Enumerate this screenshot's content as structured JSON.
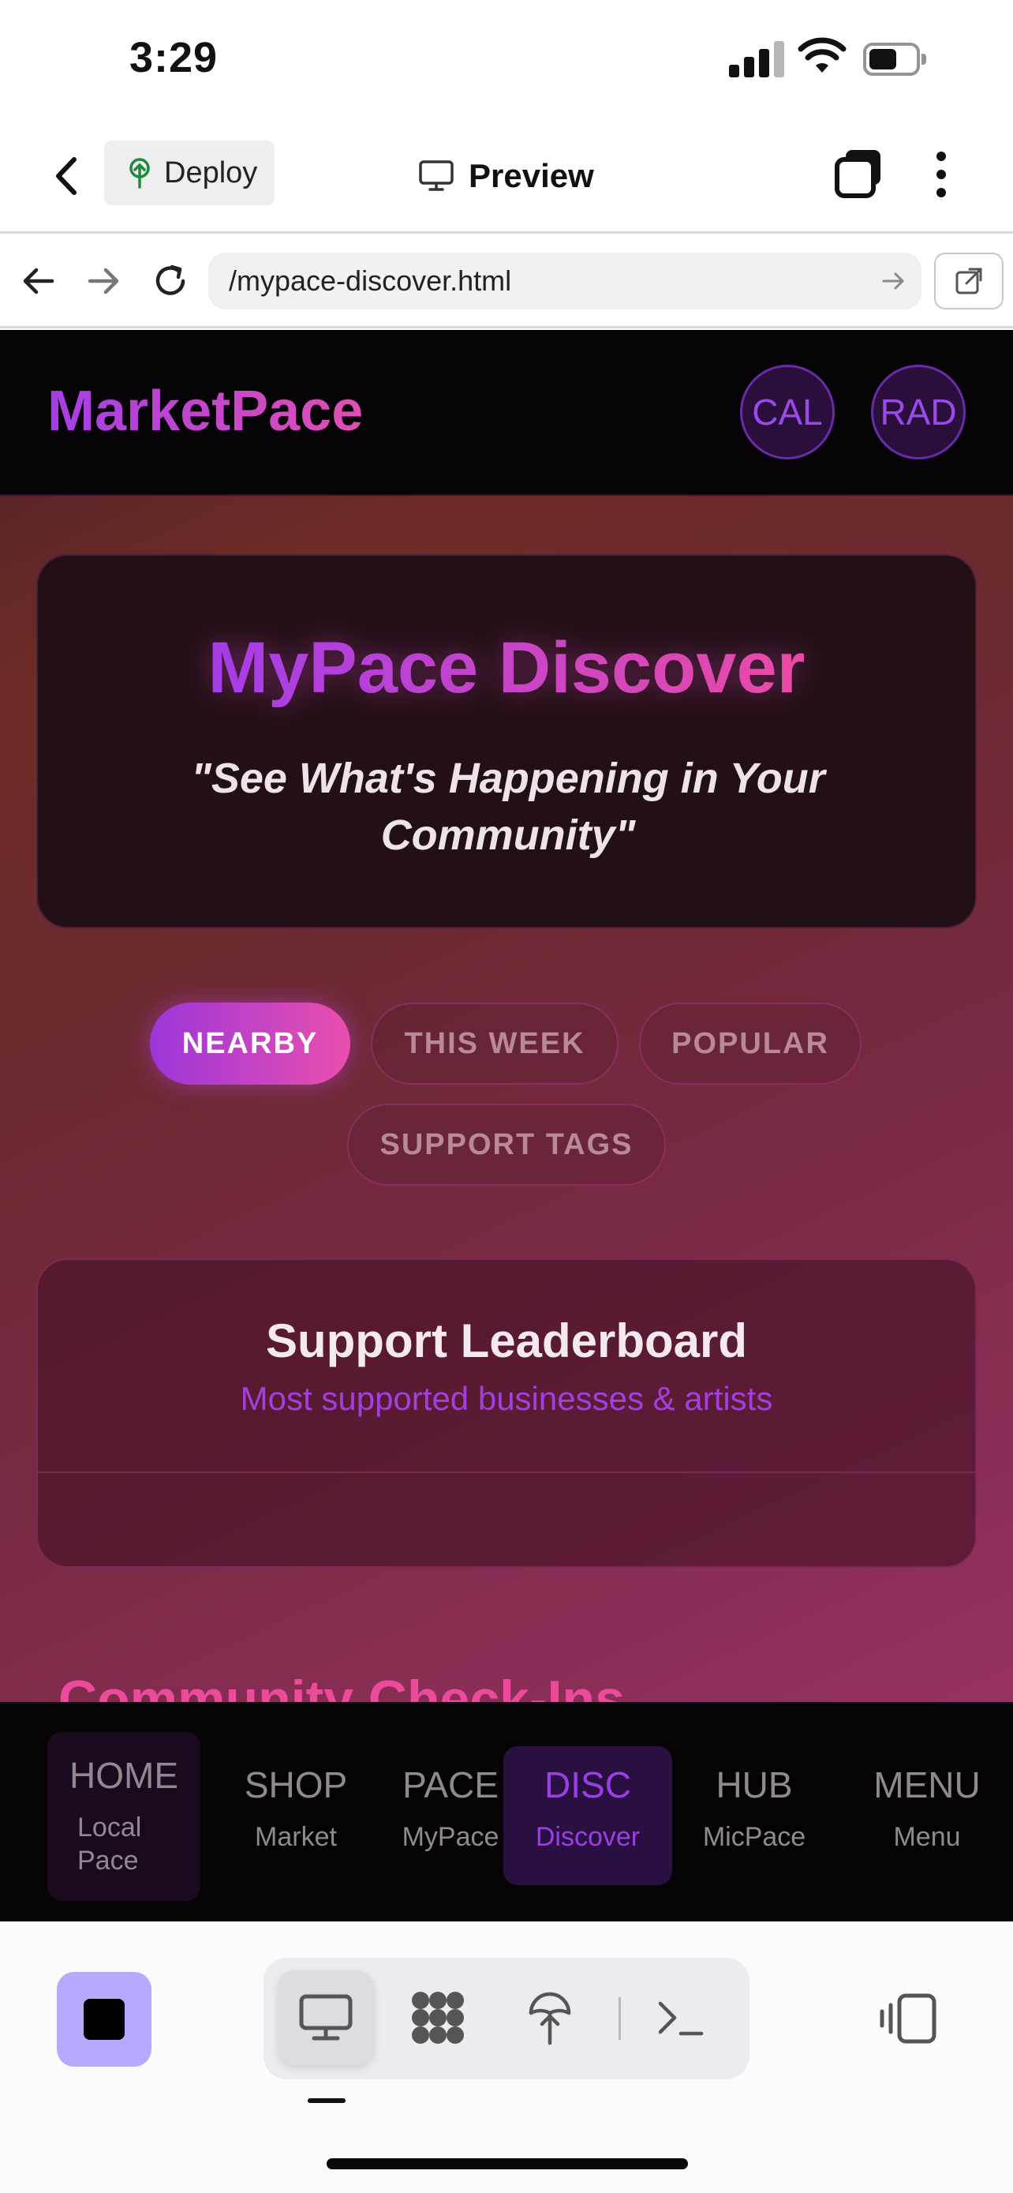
{
  "status_bar": {
    "time": "3:29"
  },
  "app_header": {
    "deploy_label": "Deploy",
    "preview_label": "Preview"
  },
  "browser": {
    "url": "/mypace-discover.html"
  },
  "site": {
    "logo": "MarketPace",
    "header_buttons": [
      "CAL",
      "RAD"
    ],
    "hero": {
      "title": "MyPace Discover",
      "subtitle": "\"See What's Happening in Your Community\""
    },
    "filters": [
      {
        "label": "NEARBY",
        "active": true
      },
      {
        "label": "THIS WEEK",
        "active": false
      },
      {
        "label": "POPULAR",
        "active": false
      },
      {
        "label": "SUPPORT TAGS",
        "active": false
      }
    ],
    "leaderboard": {
      "title": "Support Leaderboard",
      "subtitle": "Most supported businesses & artists"
    },
    "checkins_heading": "Community Check-Ins",
    "bottom_nav": [
      {
        "code": "HOME",
        "name": "Local Pace",
        "active": false
      },
      {
        "code": "SHOP",
        "name": "Market",
        "active": false
      },
      {
        "code": "PACE",
        "name": "MyPace",
        "active": false
      },
      {
        "code": "DISC",
        "name": "Discover",
        "active": true
      },
      {
        "code": "HUB",
        "name": "MicPace",
        "active": false
      },
      {
        "code": "MENU",
        "name": "Menu",
        "active": false
      }
    ],
    "colors": {
      "accent_purple": "#9b36d9",
      "accent_pink": "#ea4fae",
      "nav_active": "#9b3ee4"
    }
  },
  "toolbar": {
    "icons": [
      "stop-icon",
      "desktop-icon",
      "grid-apps-icon",
      "deploy-icon",
      "terminal-icon",
      "side-panel-icon"
    ]
  }
}
